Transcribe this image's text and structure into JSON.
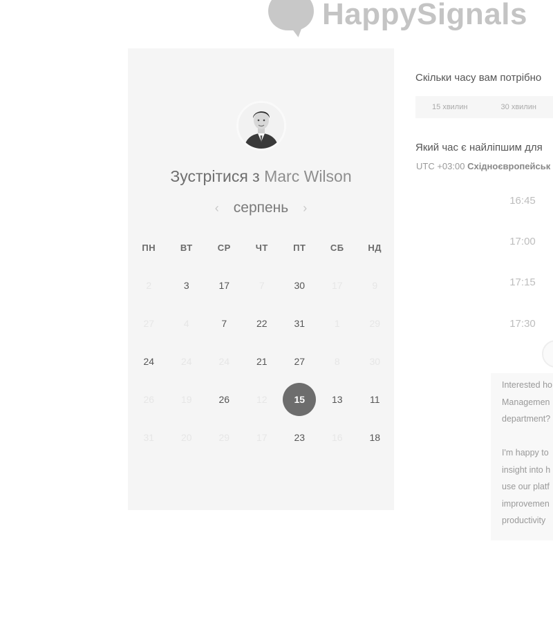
{
  "brand": {
    "name": "HappySignals"
  },
  "host": {
    "title_prefix": "Зустрітися з",
    "name": "Marc Wilson"
  },
  "calendar": {
    "month": "серпень",
    "prev_icon": "chevron-left-icon",
    "next_icon": "chevron-right-icon",
    "weekdays": [
      "ПН",
      "ВТ",
      "СР",
      "ЧТ",
      "ПТ",
      "СБ",
      "НД"
    ],
    "weeks": [
      [
        {
          "t": "2",
          "faint": true
        },
        {
          "t": "3",
          "faint": false
        },
        {
          "t": "17",
          "faint": false
        },
        {
          "t": "7",
          "faint": true
        },
        {
          "t": "30",
          "faint": false
        },
        {
          "t": "17",
          "faint": true
        },
        {
          "t": "9",
          "faint": true
        }
      ],
      [
        {
          "t": "27",
          "faint": true
        },
        {
          "t": "4",
          "faint": true
        },
        {
          "t": "7",
          "faint": false
        },
        {
          "t": "22",
          "faint": false
        },
        {
          "t": "31",
          "faint": false
        },
        {
          "t": "1",
          "faint": true
        },
        {
          "t": "29",
          "faint": true
        }
      ],
      [
        {
          "t": "24",
          "faint": false
        },
        {
          "t": "24",
          "faint": true
        },
        {
          "t": "24",
          "faint": true
        },
        {
          "t": "21",
          "faint": false
        },
        {
          "t": "27",
          "faint": false
        },
        {
          "t": "8",
          "faint": true
        },
        {
          "t": "30",
          "faint": true
        }
      ],
      [
        {
          "t": "26",
          "faint": true
        },
        {
          "t": "19",
          "faint": true
        },
        {
          "t": "26",
          "faint": false
        },
        {
          "t": "12",
          "faint": true
        },
        {
          "t": "15",
          "faint": false,
          "selected": true
        },
        {
          "t": "13",
          "faint": false
        },
        {
          "t": "11",
          "faint": false
        }
      ],
      [
        {
          "t": "31",
          "faint": true
        },
        {
          "t": "20",
          "faint": true
        },
        {
          "t": "29",
          "faint": true
        },
        {
          "t": "17",
          "faint": true
        },
        {
          "t": "23",
          "faint": false
        },
        {
          "t": "16",
          "faint": true
        },
        {
          "t": "18",
          "faint": false
        }
      ]
    ]
  },
  "duration": {
    "question": "Скільки часу вам потрібно",
    "options": [
      "15 хвилин",
      "30 хвилин"
    ]
  },
  "time": {
    "question": "Який час є найліпшим для",
    "timezone_offset": "UTC +03:00",
    "timezone_name": "Східноєвропейськ",
    "slots": [
      "16:45",
      "17:00",
      "17:15",
      "17:30"
    ]
  },
  "message": {
    "paragraphs": [
      [
        "Interested ho",
        "Managemen",
        "department?"
      ],
      [
        "I'm happy to",
        "insight into h",
        "use our platf",
        "improvemen",
        "productivity"
      ]
    ]
  },
  "colors": {
    "panel_bg": "#f5f5f5",
    "selected_day": "#6d6d6d",
    "logo": "#c4c4c4"
  }
}
